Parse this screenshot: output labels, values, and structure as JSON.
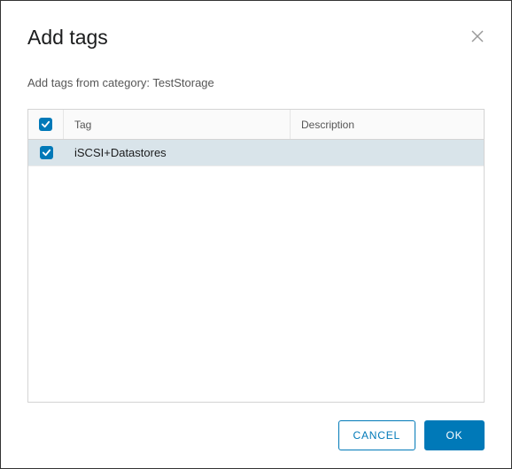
{
  "dialog": {
    "title": "Add tags",
    "subtitle": "Add tags from category: TestStorage"
  },
  "table": {
    "headers": {
      "tag": "Tag",
      "description": "Description"
    },
    "rows": [
      {
        "tag": "iSCSI+Datastores",
        "description": ""
      }
    ]
  },
  "footer": {
    "cancel": "CANCEL",
    "ok": "OK"
  }
}
